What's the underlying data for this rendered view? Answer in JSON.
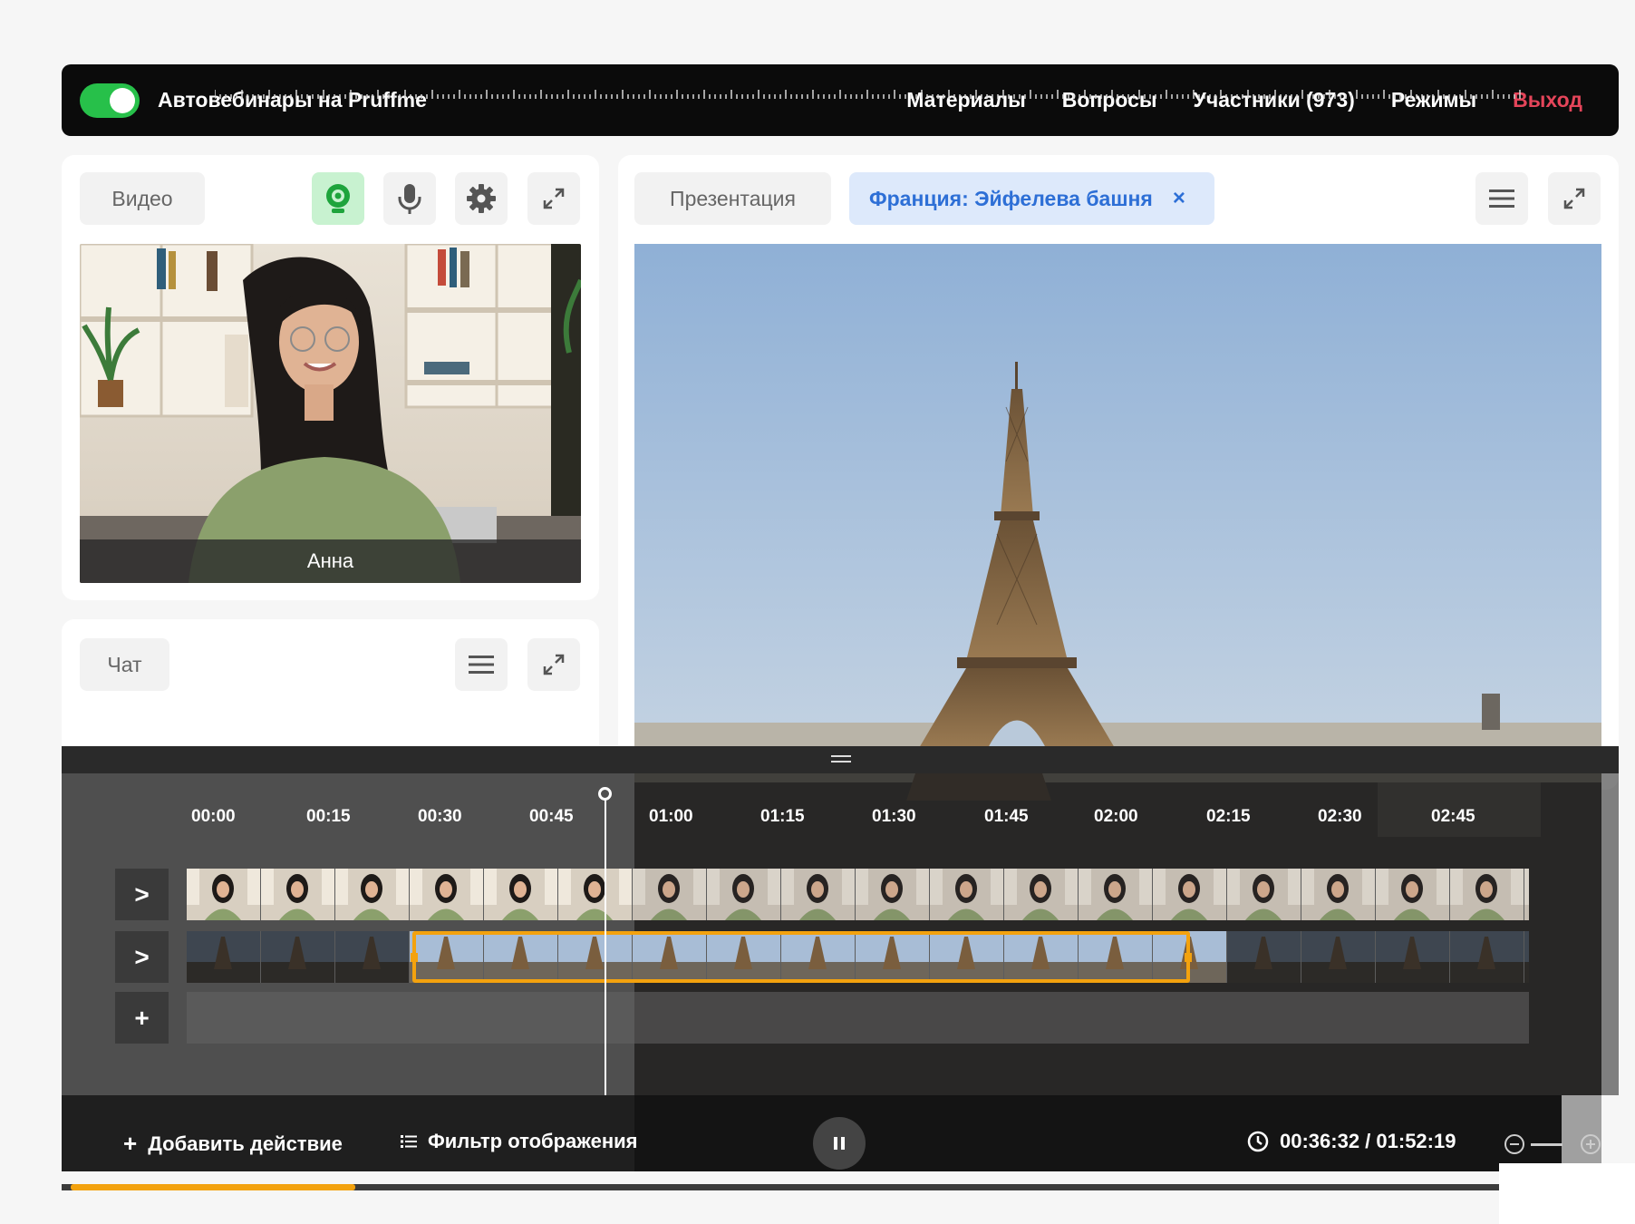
{
  "header": {
    "title": "Автовебинары на Pruffme",
    "toggle_on": true,
    "nav": {
      "materials": "Материалы",
      "questions": "Вопросы",
      "participants": "Участники (973)",
      "modes": "Режимы",
      "exit": "Выход"
    },
    "colors": {
      "toggle": "#27c04a",
      "exit": "#e5455a"
    }
  },
  "video_panel": {
    "label": "Видео",
    "icons": [
      "webcam-icon",
      "microphone-icon",
      "gear-icon",
      "expand-icon"
    ],
    "speaker_name": "Анна"
  },
  "chat_panel": {
    "label": "Чат",
    "icons": [
      "menu-icon",
      "expand-icon"
    ]
  },
  "presentation_panel": {
    "label": "Презентация",
    "active_file": "Франция: Эйфелева башня",
    "close_symbol": "×",
    "icons": [
      "menu-icon",
      "expand-icon"
    ]
  },
  "timeline": {
    "ticks": [
      "00:00",
      "00:15",
      "00:30",
      "00:45",
      "01:00",
      "01:15",
      "01:30",
      "01:45",
      "02:00",
      "02:15",
      "02:30",
      "02:45"
    ],
    "row_buttons": [
      ">",
      ">",
      "+"
    ],
    "accent": "#f3a20e"
  },
  "controls": {
    "add_action_plus": "+",
    "add_action": "Добавить действие",
    "filter": "Фильтр отображения",
    "time": "00:36:32 / 01:52:19",
    "progress": 0.19
  }
}
